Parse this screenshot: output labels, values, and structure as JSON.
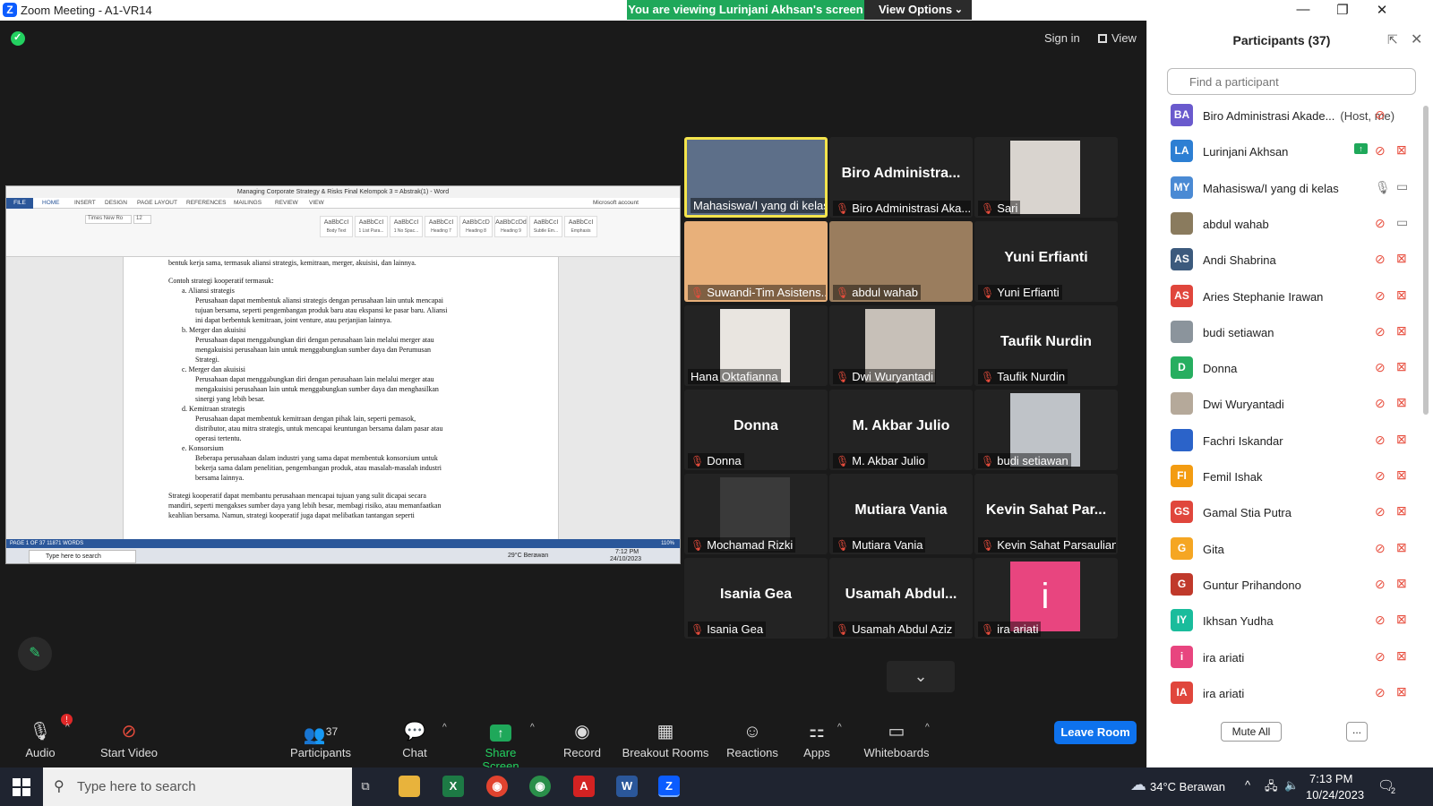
{
  "window": {
    "title": "Zoom Meeting - A1-VR14",
    "logo": "Z",
    "viewing_banner": "You are viewing Lurinjani Akhsan's screen",
    "view_options": "View Options",
    "sign_in": "Sign in",
    "view": "View"
  },
  "shared_screen": {
    "word_title": "Managing Corporate Strategy & Risks Final Kelompok 3 = Abstrak(1) - Word",
    "tabs": [
      "FILE",
      "HOME",
      "INSERT",
      "DESIGN",
      "PAGE LAYOUT",
      "REFERENCES",
      "MAILINGS",
      "REVIEW",
      "VIEW"
    ],
    "account": "Microsoft account",
    "styles": [
      "AaBbCcI",
      "AaBbCcI",
      "AaBbCcI",
      "AaBbCcI",
      "AaBbCcD",
      "AaBbCcDd",
      "AaBbCcI",
      "AaBbCcI"
    ],
    "style_names": [
      "Body Text",
      "1 List Para...",
      "1 No Spac...",
      "Heading 7",
      "Heading 8",
      "Heading 9",
      "Subtle Em...",
      "Emphasis"
    ],
    "font_name": "Times New Ro",
    "font_size": "12",
    "doc_lines": [
      "bentuk kerja sama, termasuk aliansi strategis, kemitraan, merger, akuisisi, dan lainnya.",
      "Contoh strategi kooperatif termasuk:",
      "a.   Aliansi strategis",
      "Perusahaan dapat membentuk aliansi strategis dengan perusahaan lain untuk mencapai",
      "tujuan bersama, seperti pengembangan produk baru atau ekspansi ke pasar baru. Aliansi",
      "ini dapat berbentuk kemitraan, joint venture, atau perjanjian lainnya.",
      "b.   Merger dan akuisisi",
      "Perusahaan dapat menggabungkan diri dengan perusahaan lain melalui merger atau",
      "mengakuisisi perusahaan lain untuk menggabungkan sumber daya dan Perumusan",
      "Strategi.",
      "c.   Merger dan akuisisi",
      "Perusahaan dapat menggabungkan diri dengan perusahaan lain melalui merger atau",
      "mengakuisisi perusahaan lain untuk menggabungkan sumber daya dan menghasilkan",
      "sinergi yang lebih besar.",
      "d.   Kemitraan strategis",
      "Perusahaan dapat membentuk kemitraan dengan pihak lain, seperti pemasok,",
      "distributor, atau mitra strategis, untuk mencapai keuntungan bersama dalam pasar atau",
      "operasi tertentu.",
      "e.   Konsorsium",
      "Beberapa perusahaan dalam industri yang sama dapat membentuk konsorsium untuk",
      "bekerja sama dalam penelitian, pengembangan produk, atau masalah-masalah industri",
      "bersama lainnya.",
      "Strategi kooperatif dapat membantu perusahaan mencapai tujuan yang sulit dicapai secara",
      "mandiri, seperti mengakses sumber daya yang lebih besar, membagi risiko, atau memanfaatkan",
      "keahlian bersama. Namun, strategi kooperatif juga dapat melibatkan tantangan seperti"
    ],
    "status_bar": "PAGE 1 OF 37    11871 WORDS",
    "zoom_pct": "110%",
    "inner_search": "Type here to search",
    "inner_weather": "29°C  Berawan",
    "inner_time": "7:12 PM",
    "inner_date": "24/10/2023"
  },
  "video_tiles": [
    {
      "name": "Mahasiswa/I yang di kelas",
      "type": "photo",
      "muted": false,
      "active": true,
      "color": "#5d6f89"
    },
    {
      "name": "Biro Administrasi Aka...",
      "big": "Biro Administra...",
      "type": "name",
      "muted": true
    },
    {
      "name": "Sari",
      "type": "photo",
      "muted": true,
      "color": "#d9d4cf"
    },
    {
      "name": "Suwandi-Tim Asistens...",
      "type": "photo",
      "muted": true,
      "color": "#e8b07a"
    },
    {
      "name": "abdul wahab",
      "type": "photo",
      "muted": true,
      "color": "#9a7d5e"
    },
    {
      "name": "Yuni Erfianti",
      "big": "Yuni Erfianti",
      "type": "name",
      "muted": true
    },
    {
      "name": "Hana Oktafianna",
      "type": "photo",
      "muted": false,
      "color": "#e9e5e0"
    },
    {
      "name": "Dwi Wuryantadi",
      "type": "photo",
      "muted": true,
      "color": "#c7c0b8"
    },
    {
      "name": "Taufik Nurdin",
      "big": "Taufik Nurdin",
      "type": "name",
      "muted": true
    },
    {
      "name": "Donna",
      "big": "Donna",
      "type": "name",
      "muted": true
    },
    {
      "name": "M. Akbar Julio",
      "big": "M. Akbar Julio",
      "type": "name",
      "muted": true
    },
    {
      "name": "budi setiawan",
      "type": "photo",
      "muted": true,
      "color": "#bfc3c8"
    },
    {
      "name": "Mochamad Rizki",
      "type": "photo",
      "muted": true,
      "color": "#3a3a3a"
    },
    {
      "name": "Mutiara Vania",
      "big": "Mutiara Vania",
      "type": "name",
      "muted": true
    },
    {
      "name": "Kevin Sahat Parsaulian",
      "big": "Kevin Sahat Par...",
      "type": "name",
      "muted": true
    },
    {
      "name": "Isania Gea",
      "big": "Isania Gea",
      "type": "name",
      "muted": true
    },
    {
      "name": "Usamah Abdul Aziz",
      "big": "Usamah Abdul...",
      "type": "name",
      "muted": true
    },
    {
      "name": "ira ariati",
      "type": "letter",
      "letter": "i",
      "muted": true,
      "color": "#e8457f"
    }
  ],
  "toolbar": {
    "audio": "Audio",
    "audio_badge": "!",
    "start_video": "Start Video",
    "participants": "Participants",
    "participants_count": "37",
    "chat": "Chat",
    "share_screen": "Share Screen",
    "record": "Record",
    "breakout_rooms": "Breakout Rooms",
    "reactions": "Reactions",
    "apps": "Apps",
    "whiteboards": "Whiteboards",
    "leave_room": "Leave Room"
  },
  "panel": {
    "title": "Participants (37)",
    "search_placeholder": "Find a participant",
    "mute_all": "Mute All",
    "more": "...",
    "participants": [
      {
        "initials": "BA",
        "name": "Biro Administrasi Akade...",
        "role": "(Host, me)",
        "color": "#6a5acd",
        "mic": "off",
        "cam": "none"
      },
      {
        "initials": "LA",
        "name": "Lurinjani Akhsan",
        "color": "#2d7fd3",
        "mic": "off",
        "cam": "off",
        "sharing": true
      },
      {
        "initials": "MY",
        "name": "Mahasiswa/I yang di kelas",
        "color": "#4a8ad4",
        "mic": "on",
        "cam": "on"
      },
      {
        "initials": "",
        "name": "abdul wahab",
        "color": "#8a7b5e",
        "mic": "off",
        "cam": "on"
      },
      {
        "initials": "AS",
        "name": "Andi Shabrina",
        "color": "#3c5a7d",
        "mic": "off",
        "cam": "off"
      },
      {
        "initials": "AS",
        "name": "Aries Stephanie Irawan",
        "color": "#e0463c",
        "mic": "off",
        "cam": "off"
      },
      {
        "initials": "",
        "name": "budi setiawan",
        "color": "#8b949c",
        "mic": "off",
        "cam": "off"
      },
      {
        "initials": "D",
        "name": "Donna",
        "color": "#27ae60",
        "mic": "off",
        "cam": "off"
      },
      {
        "initials": "",
        "name": "Dwi Wuryantadi",
        "color": "#b5a99a",
        "mic": "off",
        "cam": "off"
      },
      {
        "initials": "",
        "name": "Fachri Iskandar",
        "color": "#2b63c9",
        "mic": "off",
        "cam": "off"
      },
      {
        "initials": "FI",
        "name": "Femil Ishak",
        "color": "#f39c12",
        "mic": "off",
        "cam": "off"
      },
      {
        "initials": "GS",
        "name": "Gamal Stia Putra",
        "color": "#e0463c",
        "mic": "off",
        "cam": "off"
      },
      {
        "initials": "G",
        "name": "Gita",
        "color": "#f5a623",
        "mic": "off",
        "cam": "off"
      },
      {
        "initials": "G",
        "name": "Guntur Prihandono",
        "color": "#c0392b",
        "mic": "off",
        "cam": "off"
      },
      {
        "initials": "IY",
        "name": "Ikhsan Yudha",
        "color": "#1abc9c",
        "mic": "off",
        "cam": "off"
      },
      {
        "initials": "i",
        "name": "ira ariati",
        "color": "#e8457f",
        "mic": "off",
        "cam": "off"
      },
      {
        "initials": "IA",
        "name": "ira ariati",
        "color": "#e0463c",
        "mic": "off",
        "cam": "off"
      }
    ]
  },
  "taskbar": {
    "search": "Type here to search",
    "weather": "34°C  Berawan",
    "time": "7:13 PM",
    "date": "10/24/2023",
    "notif": "2"
  }
}
